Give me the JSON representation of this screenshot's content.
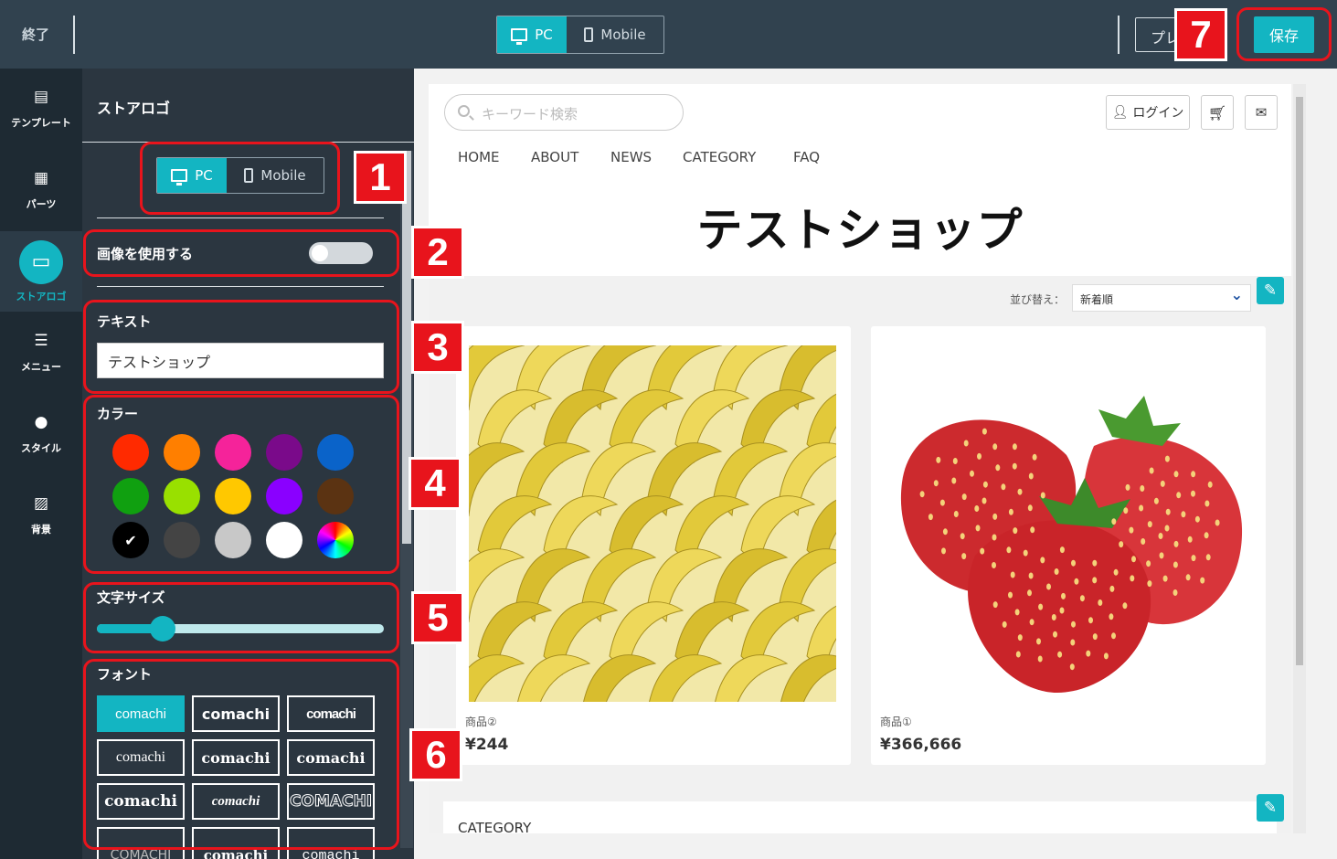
{
  "topbar": {
    "exit_label": "終了",
    "device_pc": "PC",
    "device_mobile": "Mobile",
    "preview_label": "プレ",
    "save_label": "保存"
  },
  "leftnav": {
    "items": [
      {
        "label": "テンプレート",
        "icon": "template-icon"
      },
      {
        "label": "パーツ",
        "icon": "parts-icon"
      },
      {
        "label": "ストアロゴ",
        "icon": "store-icon"
      },
      {
        "label": "メニュー",
        "icon": "menu-list-icon"
      },
      {
        "label": "スタイル",
        "icon": "palette-icon"
      },
      {
        "label": "背景",
        "icon": "background-icon"
      }
    ]
  },
  "panel": {
    "title": "ストアロゴ",
    "device_pc": "PC",
    "device_mobile": "Mobile",
    "use_image_label": "画像を使用する",
    "use_image_on": false,
    "text_label": "テキスト",
    "text_value": "テストショップ",
    "color_label": "カラー",
    "colors": [
      "#ff2a00",
      "#ff7f00",
      "#f5239a",
      "#7a0a8a",
      "#0a63c9",
      "#10a010",
      "#99e000",
      "#ffc800",
      "#8a00ff",
      "#5b3312",
      "#000000",
      "#444444",
      "#c8c8c8",
      "#ffffff",
      "rainbow"
    ],
    "selected_color": "#000000",
    "size_label": "文字サイズ",
    "size_value": 0.23,
    "font_label": "フォント",
    "fonts": [
      {
        "label": "comachi",
        "style": "sans"
      },
      {
        "label": "comachi",
        "style": "sans-bold"
      },
      {
        "label": "comachi",
        "style": "condensed-bold"
      },
      {
        "label": "comachi",
        "style": "serif"
      },
      {
        "label": "comachi",
        "style": "serif-bold"
      },
      {
        "label": "comachi",
        "style": "slab-bold"
      },
      {
        "label": "comachi",
        "style": "black-serif"
      },
      {
        "label": "comachi",
        "style": "script"
      },
      {
        "label": "COMACHI",
        "style": "outline"
      },
      {
        "label": "COMACHI",
        "style": "thin"
      },
      {
        "label": "comachi",
        "style": "decorative"
      },
      {
        "label": "comachi",
        "style": "typewriter"
      }
    ]
  },
  "callouts": [
    "1",
    "2",
    "3",
    "4",
    "5",
    "6",
    "7"
  ],
  "shop": {
    "search_placeholder": "キーワード検索",
    "login_label": "ログイン",
    "nav": [
      "HOME",
      "ABOUT",
      "NEWS",
      "CATEGORY",
      "FAQ"
    ],
    "logo_text": "テストショップ",
    "sort_label": "並び替え：",
    "sort_value": "新着順",
    "products": [
      {
        "name": "商品②",
        "price": "¥244",
        "image": "banana"
      },
      {
        "name": "商品①",
        "price": "¥366,666",
        "image": "strawberry"
      }
    ],
    "category_title": "CATEGORY"
  }
}
